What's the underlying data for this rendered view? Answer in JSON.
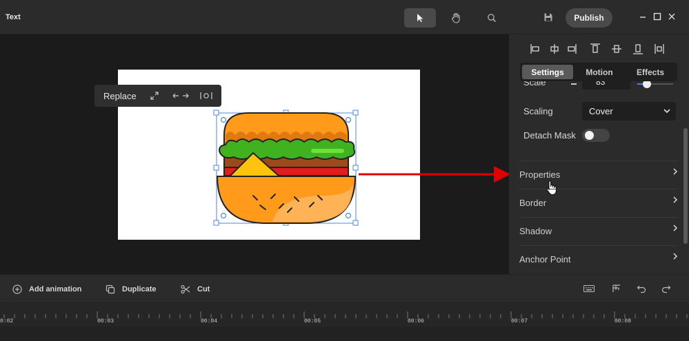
{
  "app": {
    "title": "Text"
  },
  "toolbar": {
    "publish_label": "Publish"
  },
  "context_toolbar": {
    "replace_label": "Replace"
  },
  "panel": {
    "tabs": [
      {
        "label": "Settings",
        "active": true
      },
      {
        "label": "Motion",
        "active": false
      },
      {
        "label": "Effects",
        "active": false
      }
    ],
    "scale_label": "Scale",
    "scale_value": "83",
    "scaling_label": "Scaling",
    "scaling_value": "Cover",
    "detach_mask_label": "Detach Mask",
    "detach_mask_on": false,
    "sections": [
      "Properties",
      "Border",
      "Shadow",
      "Anchor Point"
    ]
  },
  "bottom_actions": {
    "add_animation": "Add animation",
    "duplicate": "Duplicate",
    "cut": "Cut"
  },
  "timeline": {
    "ticks": [
      "0:02",
      "00:03",
      "00:04",
      "00:05",
      "00:06",
      "00:07",
      "00:08"
    ]
  },
  "colors": {
    "accent_annotation": "#e00000",
    "selection": "#4a86e8"
  }
}
